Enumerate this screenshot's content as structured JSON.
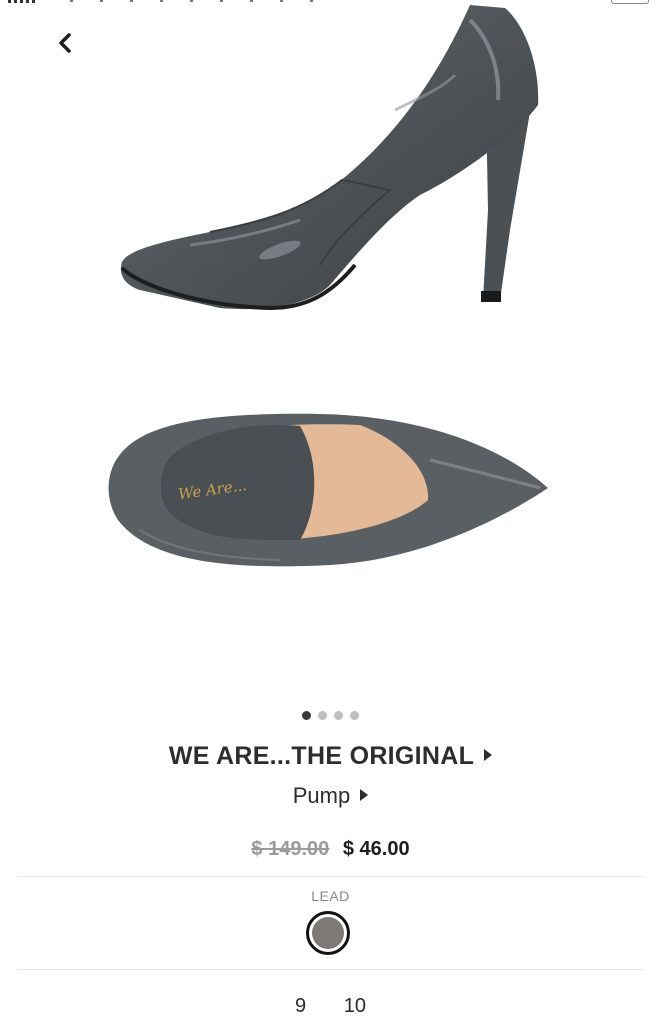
{
  "product": {
    "brand": "WE ARE...THE ORIGINAL",
    "category": "Pump",
    "original_price": "$ 149.00",
    "sale_price": "$ 46.00",
    "color_name": "LEAD",
    "color_hex": "#7d7974",
    "sizes": [
      "9",
      "10"
    ]
  },
  "gallery": {
    "total_images": 4,
    "active_index": 0,
    "insole_print": "We Are..."
  },
  "icons": {
    "back": "chevron-left-icon",
    "brand_arrow": "triangle-right-icon",
    "category_arrow": "triangle-right-icon"
  },
  "colors": {
    "shoe": "#565b60",
    "shoe_highlight": "#8b9096",
    "insole": "#e3b997",
    "text": "#2d2d2d",
    "old_price": "#9b9b9b"
  }
}
